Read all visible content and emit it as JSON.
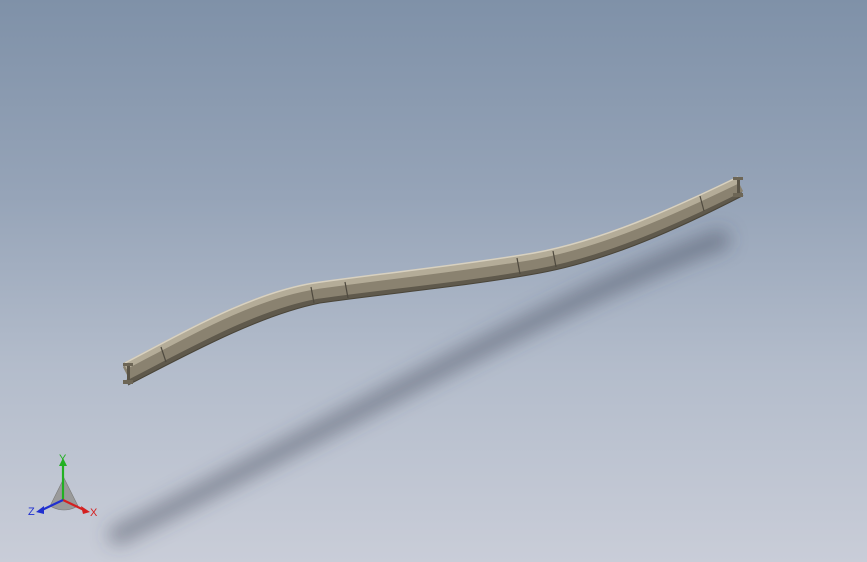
{
  "viewport": {
    "background_top": "#7f91a8",
    "background_bottom": "#c9cdd8",
    "model": "curved-i-beam-rail",
    "model_color": "#9a917e",
    "model_highlight": "#c9c1ae",
    "model_shadow": "#5f594c"
  },
  "triad": {
    "x_label": "X",
    "y_label": "Y",
    "z_label": "Z",
    "x_color": "#d42020",
    "y_color": "#22b022",
    "z_color": "#2030d0"
  }
}
